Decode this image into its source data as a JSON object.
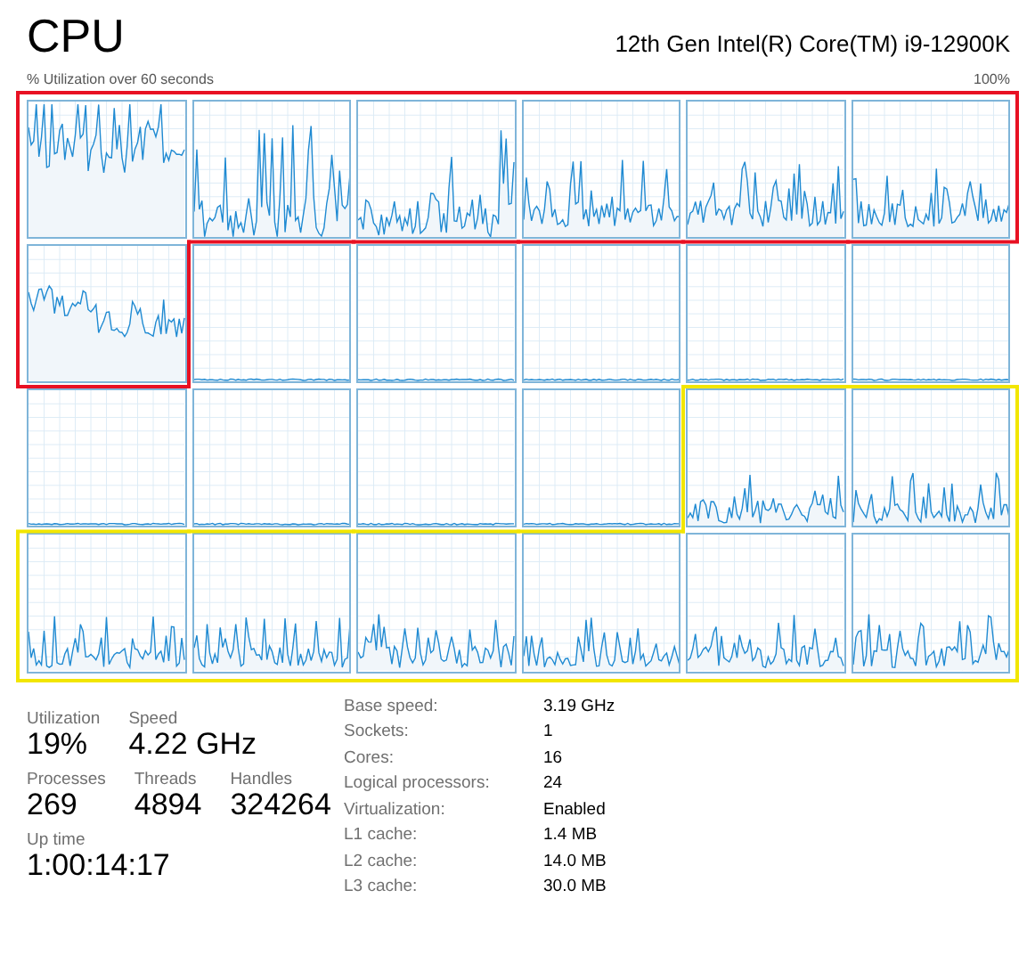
{
  "title": "CPU",
  "processor": "12th Gen Intel(R) Core(TM) i9-12900K",
  "graph_caption": "% Utilization over 60 seconds",
  "graph_max": "100%",
  "graphs": [
    {
      "kind": "busy",
      "color": "#e81123"
    },
    {
      "kind": "spiky",
      "color": "#e81123"
    },
    {
      "kind": "spiky",
      "color": "#e81123"
    },
    {
      "kind": "moderate",
      "color": "#e81123"
    },
    {
      "kind": "moderate",
      "color": "#e81123"
    },
    {
      "kind": "moderate",
      "color": "#e81123"
    },
    {
      "kind": "heavy",
      "color": "#e81123"
    },
    {
      "kind": "idle"
    },
    {
      "kind": "idle"
    },
    {
      "kind": "idle"
    },
    {
      "kind": "idle"
    },
    {
      "kind": "idle"
    },
    {
      "kind": "idle"
    },
    {
      "kind": "idle"
    },
    {
      "kind": "idle"
    },
    {
      "kind": "idle"
    },
    {
      "kind": "low",
      "color": "#f2e600"
    },
    {
      "kind": "low",
      "color": "#f2e600"
    },
    {
      "kind": "low",
      "color": "#f2e600"
    },
    {
      "kind": "low",
      "color": "#f2e600"
    },
    {
      "kind": "low",
      "color": "#f2e600"
    },
    {
      "kind": "low",
      "color": "#f2e600"
    },
    {
      "kind": "low",
      "color": "#f2e600"
    },
    {
      "kind": "low",
      "color": "#f2e600"
    }
  ],
  "stats": [
    [
      {
        "label": "Utilization",
        "value": "19%"
      },
      {
        "label": "Speed",
        "value": "4.22 GHz"
      }
    ],
    [
      {
        "label": "Processes",
        "value": "269"
      },
      {
        "label": "Threads",
        "value": "4894"
      },
      {
        "label": "Handles",
        "value": "324264"
      }
    ],
    [
      {
        "label": "Up time",
        "value": "1:00:14:17"
      }
    ]
  ],
  "details": [
    {
      "label": "Base speed:",
      "value": "3.19 GHz"
    },
    {
      "label": "Sockets:",
      "value": "1"
    },
    {
      "label": "Cores:",
      "value": "16"
    },
    {
      "label": "Logical processors:",
      "value": "24"
    },
    {
      "label": "Virtualization:",
      "value": "Enabled"
    },
    {
      "label": "L1 cache:",
      "value": "1.4 MB"
    },
    {
      "label": "L2 cache:",
      "value": "14.0 MB"
    },
    {
      "label": "L3 cache:",
      "value": "30.0 MB"
    }
  ]
}
